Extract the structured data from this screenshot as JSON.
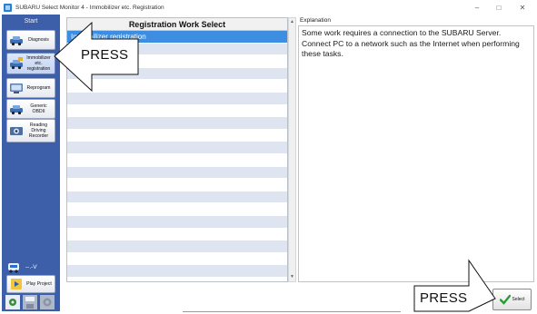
{
  "window": {
    "title": "SUBARU Select Monitor 4 - Immobilizer etc. Registration",
    "minimize": "–",
    "maximize": "□",
    "close": "✕"
  },
  "sidebar": {
    "start_label": "Start",
    "items": [
      {
        "label": "Diagnosis",
        "icon": "car-diagnosis-icon"
      },
      {
        "label": "Immobilizer etc. registration",
        "icon": "immobilizer-icon"
      },
      {
        "label": "Reprogram",
        "icon": "reprogram-icon"
      },
      {
        "label": "Generic OBDII",
        "icon": "obd-icon"
      },
      {
        "label": "Reading Driving Recorder",
        "icon": "recorder-icon"
      }
    ],
    "voltage": "--.-V",
    "play_project": "Play Project"
  },
  "list": {
    "header": "Registration Work Select",
    "selected_item": "Immobilizer registration",
    "row_count": 21
  },
  "explanation": {
    "title": "Explanation",
    "text": "Some work requires a connection to the SUBARU Server. Connect PC to a network such as the Internet when performing these tasks."
  },
  "footer": {
    "select_label": "Select"
  },
  "callouts": {
    "left": "PRESS",
    "right": "PRESS"
  },
  "colors": {
    "sidebar": "#3d5ea9",
    "selected_row": "#3d8de0",
    "alt_row": "#dfe5f0"
  }
}
